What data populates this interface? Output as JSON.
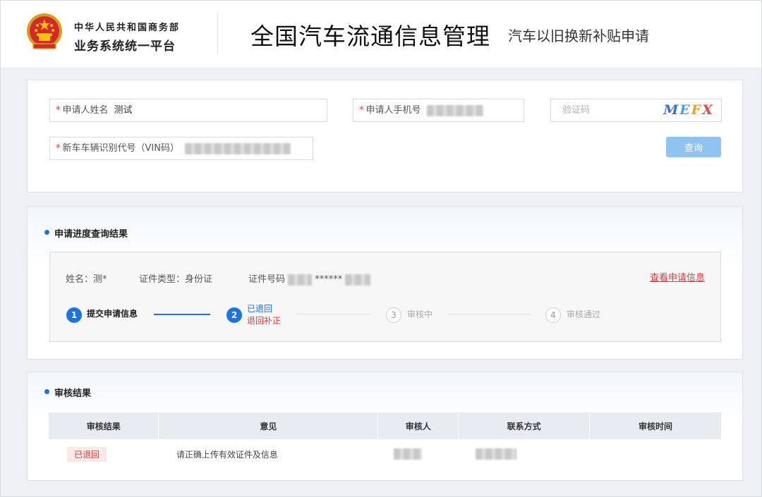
{
  "header": {
    "org_line1": "中华人民共和国商务部",
    "org_line2": "业务系统统一平台",
    "system_title": "全国汽车流通信息管理",
    "system_subtitle": "汽车以旧换新补贴申请"
  },
  "query_form": {
    "name_label": "申请人姓名",
    "name_value": "测试",
    "phone_label": "申请人手机号",
    "captcha_placeholder": "验证码",
    "captcha_chars": [
      "M",
      "E",
      "F",
      "X"
    ],
    "vin_label": "新车车辆识别代号（VIN码）",
    "query_button": "查询",
    "required_mark": "*"
  },
  "progress": {
    "section_title": "申请进度查询结果",
    "name_text": "姓名：测*",
    "id_type_text": "证件类型：身份证",
    "id_no_label": "证件号码",
    "id_no_masked": "******",
    "view_link": "查看申请信息",
    "steps": [
      {
        "num": "1",
        "label": "提交申请信息",
        "state": "done"
      },
      {
        "num": "2",
        "label": "已退回",
        "sub": "退回补正",
        "state": "current"
      },
      {
        "num": "3",
        "label": "审核中",
        "state": "pending"
      },
      {
        "num": "4",
        "label": "审核通过",
        "state": "pending"
      }
    ]
  },
  "review": {
    "section_title": "审核结果",
    "columns": [
      "审核结果",
      "意见",
      "审核人",
      "联系方式",
      "审核时间"
    ],
    "rows": [
      {
        "result": "已退回",
        "opinion": "请正确上传有效证件及信息",
        "reviewer": "",
        "contact": "",
        "time": ""
      }
    ]
  },
  "colors": {
    "primary": "#1a73e8",
    "danger": "#e53935",
    "button_bg": "#8ec3f2"
  }
}
